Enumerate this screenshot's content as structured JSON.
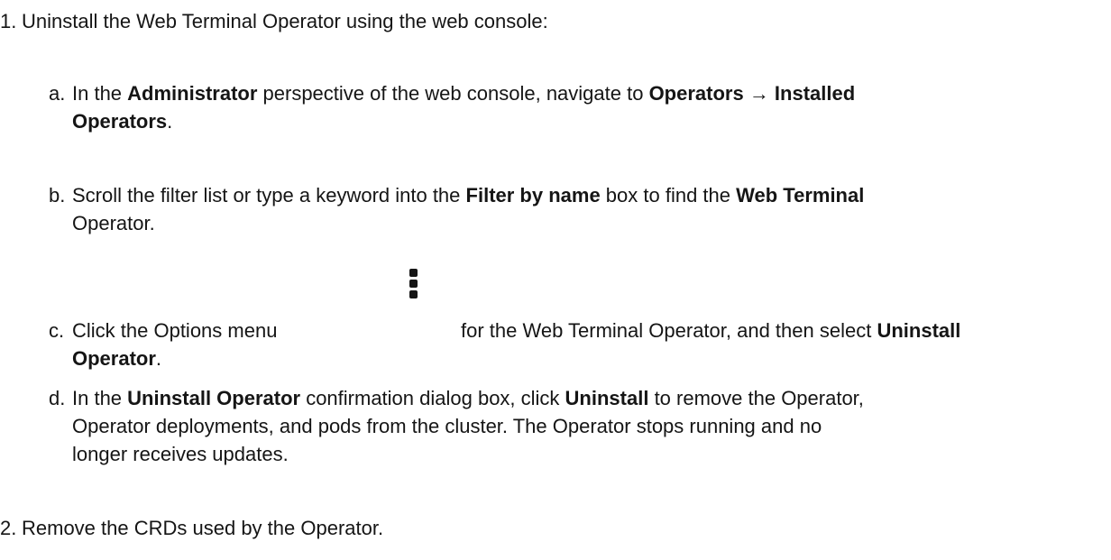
{
  "steps": [
    {
      "num": "1.",
      "text": "Uninstall the Web Terminal Operator using the web console:"
    },
    {
      "num": "2.",
      "text": "Remove the CRDs used by the Operator."
    }
  ],
  "substeps": {
    "a": {
      "letter": "a.",
      "p1": "In the ",
      "b1": "Administrator",
      "p2": " perspective of the web console, navigate to ",
      "b2": "Operators → Installed",
      "b3": "Operators",
      "p3": "."
    },
    "b": {
      "letter": "b.",
      "p1": "Scroll the filter list or type a keyword into the ",
      "b1": "Filter by name",
      "p2": " box to find the ",
      "b2": "Web Terminal",
      "p3": "Operator."
    },
    "c": {
      "letter": "c.",
      "p1": "Click the Options menu",
      "p2": "for the Web Terminal Operator, and then select ",
      "b1": "Uninstall",
      "b2": "Operator",
      "p3": "."
    },
    "d": {
      "letter": "d.",
      "p1": "In the ",
      "b1": "Uninstall Operator",
      "p2": " confirmation dialog box, click ",
      "b2": "Uninstall",
      "p3": " to remove the Operator,",
      "line2": "Operator deployments, and pods from the cluster. The Operator stops running and no",
      "line3": "longer receives updates."
    }
  },
  "icons": {
    "options_menu": "kebab-menu-icon"
  }
}
